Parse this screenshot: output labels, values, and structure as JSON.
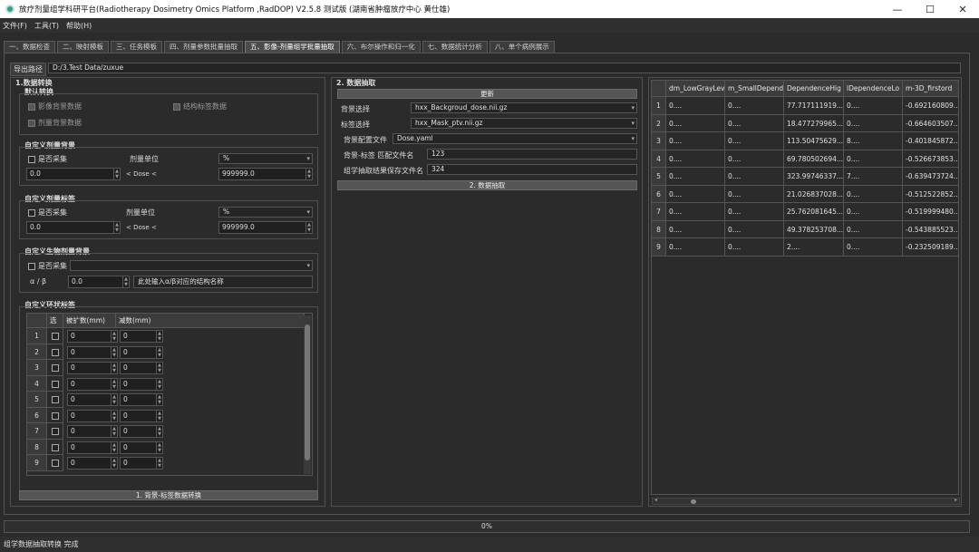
{
  "window": {
    "title": "放疗剂量组学科研平台(Radiotherapy Dosimetry Omics Platform ,RadDOP)  V2.5.8 测试版  (湖南省肿瘤放疗中心  黄仕雄)",
    "minimize": "—",
    "maximize": "☐",
    "close": "✕"
  },
  "menu": [
    "文件(F)",
    "工具(T)",
    "帮助(H)"
  ],
  "tabs": [
    "一、数据检查",
    "二、映射模板",
    "三、任务模板",
    "四、剂量参数批量抽取",
    "五、影像-剂量组学批量抽取",
    "六、布尔操作和归一化",
    "七、数据统计分析",
    "八、单个病例展示"
  ],
  "export": {
    "label": "导出路径",
    "value": "D:/3.Test Data/zuxue"
  },
  "section1": {
    "title": "1.数据转换",
    "default": {
      "title": "默认转换",
      "image_bg": "影像背景数据",
      "struct_label": "结构标签数据",
      "dose_bg": "剂量背景数据"
    },
    "custom_dose_bg": {
      "title": "自定义剂量背景",
      "collect": "是否采集",
      "unit_label": "剂量单位",
      "unit_value": "%",
      "min": "0.0",
      "between": "< Dose <",
      "max": "999999.0"
    },
    "custom_dose_label": {
      "title": "自定义剂量标签",
      "collect": "是否采集",
      "unit_label": "剂量单位",
      "unit_value": "%",
      "min": "0.0",
      "between": "< Dose <",
      "max": "999999.0"
    },
    "custom_bio_bg": {
      "title": "自定义生物剂量背景",
      "collect": "是否采集",
      "select_value": "",
      "alpha_beta_label": "α / β",
      "alpha_beta_value": "0.0",
      "hint": "此处输入α/β对应的结构名称"
    },
    "ring_label": {
      "title": "自定义环状标签",
      "col_select": "选",
      "col_expand": "被扩数(mm)",
      "col_shrink": "减数(mm)",
      "rows": [
        {
          "n": "1",
          "a": "0",
          "b": "0"
        },
        {
          "n": "2",
          "a": "0",
          "b": "0"
        },
        {
          "n": "3",
          "a": "0",
          "b": "0"
        },
        {
          "n": "4",
          "a": "0",
          "b": "0"
        },
        {
          "n": "5",
          "a": "0",
          "b": "0"
        },
        {
          "n": "6",
          "a": "0",
          "b": "0"
        },
        {
          "n": "7",
          "a": "0",
          "b": "0"
        },
        {
          "n": "8",
          "a": "0",
          "b": "0"
        },
        {
          "n": "9",
          "a": "0",
          "b": "0"
        }
      ]
    },
    "convert_button": "1. 背景-标签数据转换"
  },
  "section2": {
    "title": "2. 数据抽取",
    "refresh_button": "更新",
    "bg_select_label": "背景选择",
    "bg_select_value": "hxx_Backgroud_dose.nii.gz",
    "label_select_label": "标签选择",
    "label_select_value": "hxx_Mask_ptv.nii.gz",
    "config_label": "背景配置文件",
    "config_value": "Dose.yaml",
    "match_label": "背景-标签 匹配文件名",
    "match_value": "123",
    "save_label": "组学抽取结果保存文件名",
    "save_value": "324",
    "extract_button": "2. 数据抽取"
  },
  "results": {
    "columns": [
      "dm_LowGrayLev",
      "m_SmallDepend",
      "DependenceHig",
      "lDependenceLo",
      "m-3D_firstord"
    ],
    "rows": [
      {
        "n": "1",
        "cells": [
          "0....",
          "0....",
          "77.717111919....",
          "0....",
          "-0.692160809...."
        ]
      },
      {
        "n": "2",
        "cells": [
          "0....",
          "0....",
          "18.477279965....",
          "0....",
          "-0.664603507...."
        ]
      },
      {
        "n": "3",
        "cells": [
          "0....",
          "0....",
          "113.50475629....",
          "8....",
          "-0.401845872...."
        ]
      },
      {
        "n": "4",
        "cells": [
          "0....",
          "0....",
          "69.780502694....",
          "0....",
          "-0.526673853...."
        ]
      },
      {
        "n": "5",
        "cells": [
          "0....",
          "0....",
          "323.99746337....",
          "7....",
          "-0.639473724...."
        ]
      },
      {
        "n": "6",
        "cells": [
          "0....",
          "0....",
          "21.026837028....",
          "0....",
          "-0.512522852...."
        ]
      },
      {
        "n": "7",
        "cells": [
          "0....",
          "0....",
          "25.762081645....",
          "0....",
          "-0.519999480...."
        ]
      },
      {
        "n": "8",
        "cells": [
          "0....",
          "0....",
          "49.378253708....",
          "0....",
          "-0.543885523...."
        ]
      },
      {
        "n": "9",
        "cells": [
          "0....",
          "0....",
          "2....",
          "0....",
          "-0.232509189...."
        ]
      }
    ]
  },
  "progress": "0%",
  "status": "组学数据抽取转换 完成"
}
